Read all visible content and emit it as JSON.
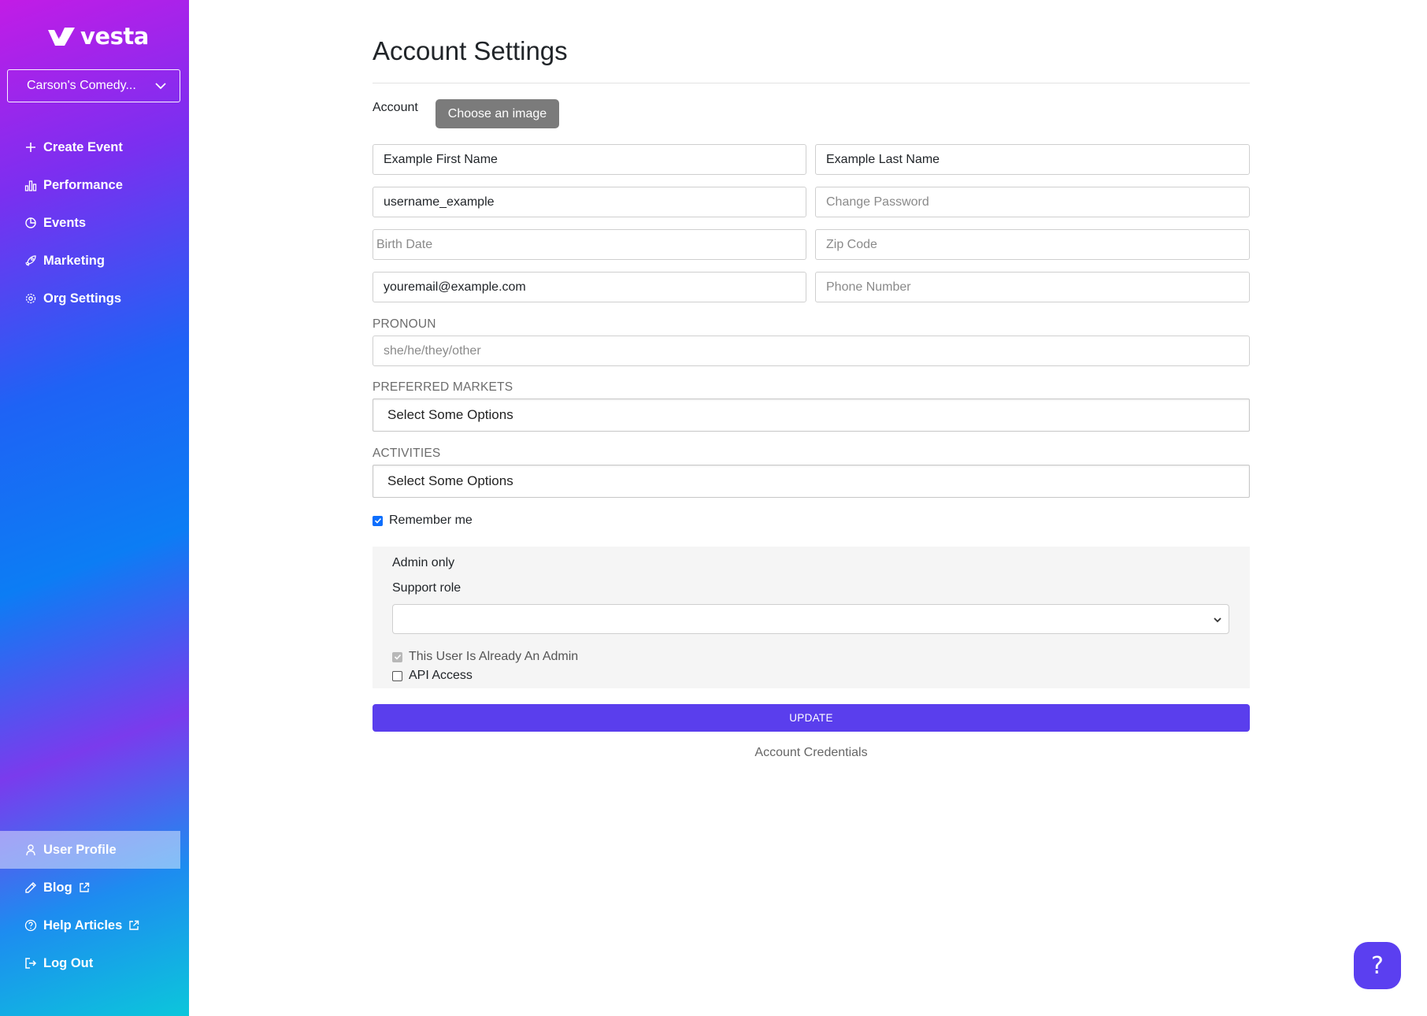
{
  "brand": {
    "name": "vesta",
    "accent": "#5a3eed"
  },
  "sidebar": {
    "org_selector": {
      "label": "Carson's Comedy..."
    },
    "top_items": [
      {
        "label": "Create Event",
        "icon": "plus-icon"
      },
      {
        "label": "Performance",
        "icon": "bar-chart-icon"
      },
      {
        "label": "Events",
        "icon": "pie-chart-icon"
      },
      {
        "label": "Marketing",
        "icon": "rocket-icon"
      },
      {
        "label": "Org Settings",
        "icon": "gear-icon"
      }
    ],
    "bottom_items": [
      {
        "label": "User Profile",
        "icon": "user-icon",
        "active": true
      },
      {
        "label": "Blog",
        "icon": "pen-icon",
        "external": true
      },
      {
        "label": "Help Articles",
        "icon": "help-circle-icon",
        "external": true
      },
      {
        "label": "Log Out",
        "icon": "logout-icon"
      }
    ]
  },
  "main": {
    "title": "Account Settings",
    "account_label": "Account",
    "choose_image_label": "Choose an image",
    "fields": {
      "first_name": {
        "value": "Example First Name"
      },
      "last_name": {
        "value": "Example Last Name"
      },
      "username": {
        "value": "username_example"
      },
      "password": {
        "placeholder": "Change Password"
      },
      "birth_date": {
        "placeholder": "Birth Date"
      },
      "zip_code": {
        "placeholder": "Zip Code"
      },
      "email": {
        "value": "youremail@example.com"
      },
      "phone": {
        "placeholder": "Phone Number"
      },
      "pronoun": {
        "label": "PRONOUN",
        "placeholder": "she/he/they/other"
      }
    },
    "preferred_markets": {
      "label": "PREFERRED MARKETS",
      "placeholder": "Select Some Options"
    },
    "activities": {
      "label": "ACTIVITIES",
      "placeholder": "Select Some Options"
    },
    "remember_me": {
      "label": "Remember me",
      "checked": true
    },
    "admin": {
      "title": "Admin only",
      "support_role_label": "Support role",
      "support_role_value": "",
      "already_admin": {
        "label": "This User Is Already An Admin",
        "checked": true,
        "disabled": true
      },
      "api_access": {
        "label": "API Access",
        "checked": false
      }
    },
    "update_label": "UPDATE",
    "credentials_link": "Account Credentials"
  },
  "help_button": {
    "label": "?"
  }
}
